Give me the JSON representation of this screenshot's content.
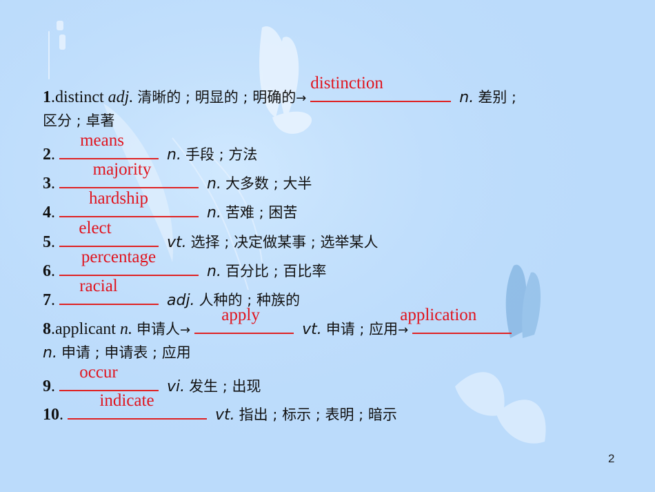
{
  "slide": {
    "page_number": "2",
    "background_color": "#bbdbfb",
    "answer_color": "#e0141e"
  },
  "items": [
    {
      "num": "1",
      "word": "distinct",
      "word_pos": "adj.",
      "word_meaning": "清晰的 ; 明显的 ; 明确的",
      "arrow": "→",
      "answer": "distinction",
      "pos": "n.",
      "meaning_line1": "差别 ;",
      "meaning_line2": "区分 ; 卓著"
    },
    {
      "num": "2",
      "answer": "means",
      "pos": "n.",
      "meaning": "手段 ; 方法"
    },
    {
      "num": "3",
      "answer": "majority",
      "pos": "n.",
      "meaning": "大多数 ; 大半"
    },
    {
      "num": "4",
      "answer": "hardship",
      "pos": "n.",
      "meaning": "苦难 ; 困苦"
    },
    {
      "num": "5",
      "answer": "elect",
      "pos": "vt.",
      "meaning": "选择 ; 决定做某事 ; 选举某人"
    },
    {
      "num": "6",
      "answer": "percentage",
      "pos": "n.",
      "meaning": "百分比 ; 百比率"
    },
    {
      "num": "7",
      "answer": "racial",
      "pos": "adj.",
      "meaning": "人种的 ; 种族的"
    },
    {
      "num": "8",
      "word": "applicant",
      "word_pos": "n.",
      "word_meaning": "申请人",
      "arrow": "→",
      "answer": "apply",
      "pos": "vt.",
      "meaning": "申请 ; 应用",
      "arrow2": "→",
      "answer2": "application",
      "pos2": "n.",
      "meaning2": "申请 ; 申请表 ; 应用"
    },
    {
      "num": "9",
      "answer": "occur",
      "pos": "vi.",
      "meaning": "发生 ; 出现"
    },
    {
      "num": "10",
      "answer": "indicate",
      "pos": "vt.",
      "meaning": "指出 ; 标示 ; 表明 ; 暗示"
    }
  ]
}
